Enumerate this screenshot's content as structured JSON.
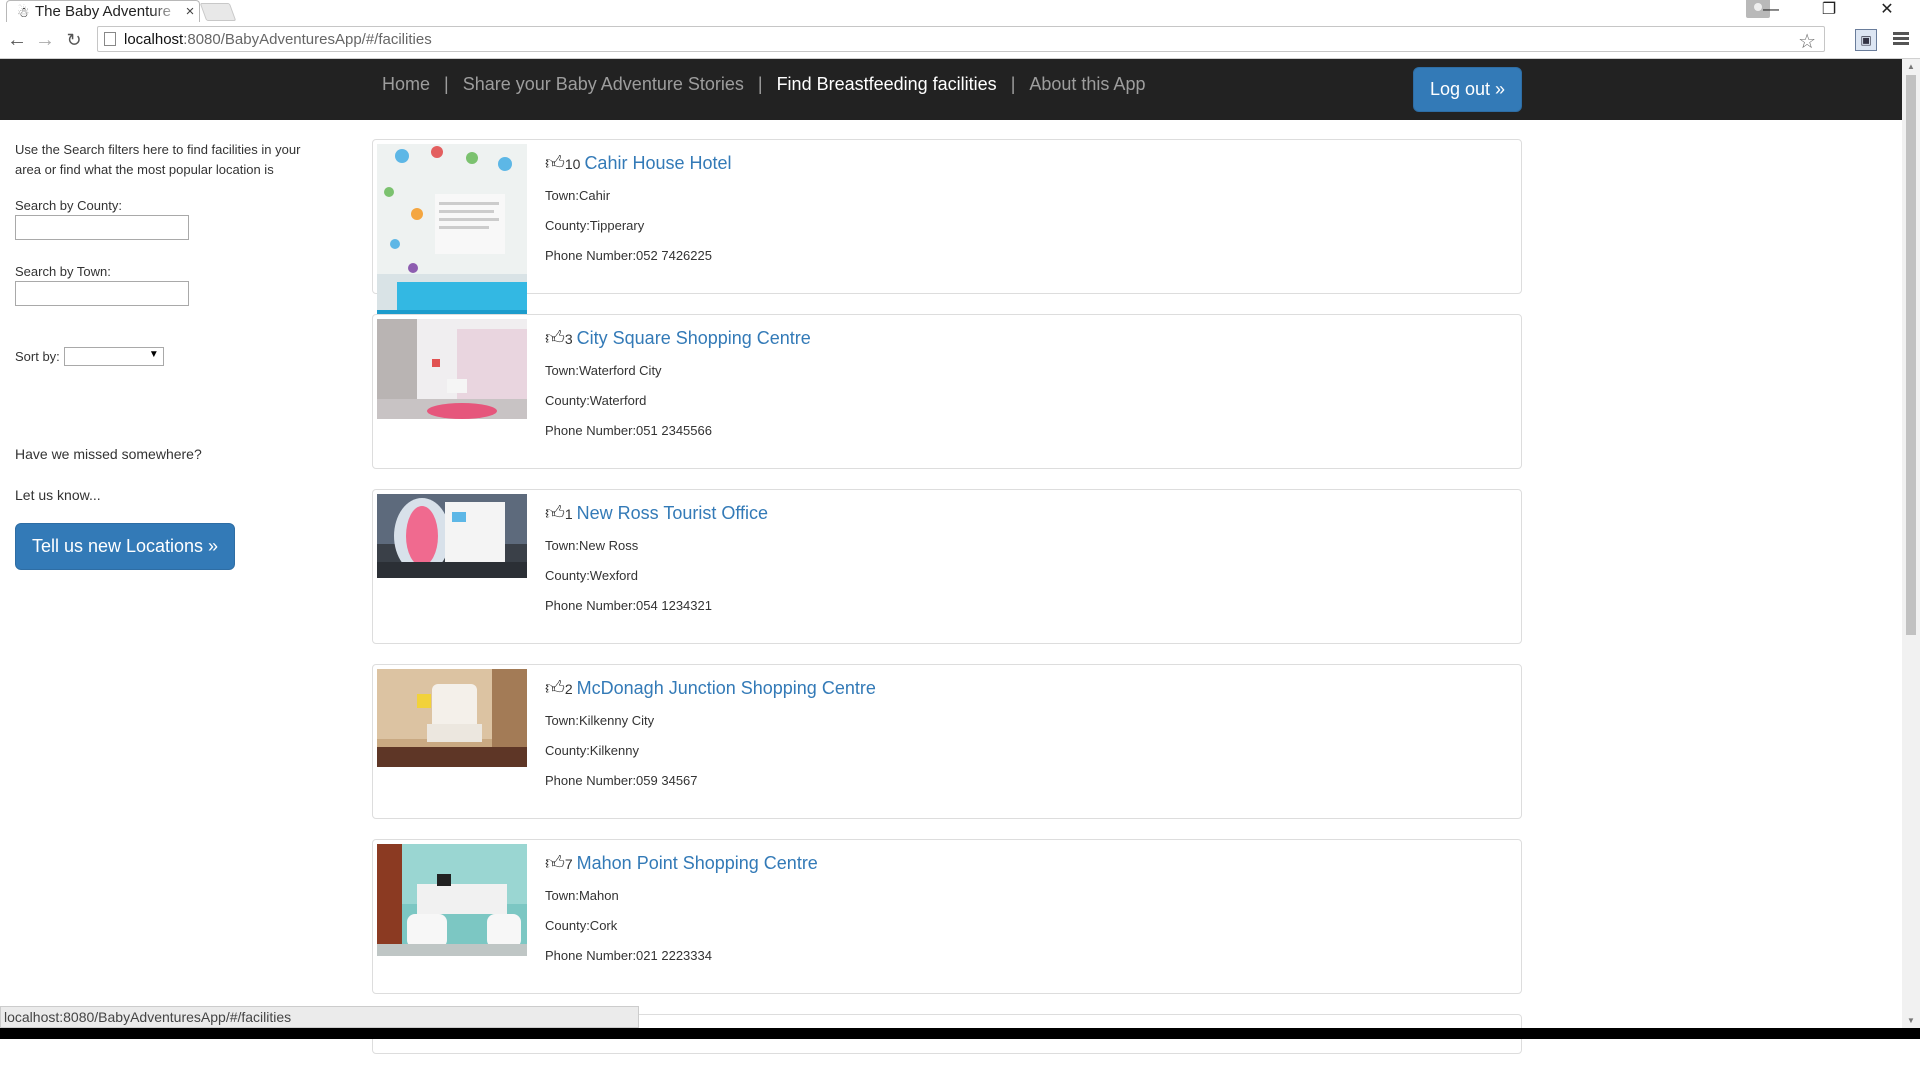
{
  "browser": {
    "tab_title": "The Baby Adventure",
    "tab_close": "×",
    "url_host": "localhost",
    "url_rest": ":8080/BabyAdventuresApp/#/facilities",
    "status_url": "localhost:8080/BabyAdventuresApp/#/facilities",
    "icons": [
      "back-icon",
      "forward-icon",
      "reload-icon",
      "star-icon",
      "menu-icon",
      "minimize-icon",
      "maximize-icon",
      "close-icon"
    ]
  },
  "nav": {
    "home": "Home",
    "share": "Share your Baby Adventure Stories",
    "find": "Find Breastfeeding facilities",
    "about": "About this App",
    "separator": "|",
    "logout": "Log out »"
  },
  "sidebar": {
    "intro": "Use the Search filters here to find facilities in your area or find what the most popular location is",
    "county_label": "Search by County:",
    "town_label": "Search by Town:",
    "sort_label": "Sort by:",
    "sort_value": "",
    "missed": "Have we missed somewhere?",
    "letus": "Let us know...",
    "new_locations_button": "Tell us new Locations »"
  },
  "facilities": [
    {
      "likes": "10",
      "name": "Cahir House Hotel",
      "town": "Town:Cahir",
      "county": "County:Tipperary",
      "phone": "Phone Number:052 7426225"
    },
    {
      "likes": "3",
      "name": "City Square Shopping Centre",
      "town": "Town:Waterford City",
      "county": "County:Waterford",
      "phone": "Phone Number:051 2345566"
    },
    {
      "likes": "1",
      "name": "New Ross Tourist Office",
      "town": "Town:New Ross",
      "county": "County:Wexford",
      "phone": "Phone Number:054 1234321"
    },
    {
      "likes": "2",
      "name": "McDonagh Junction Shopping Centre",
      "town": "Town:Kilkenny City",
      "county": "County:Kilkenny",
      "phone": "Phone Number:059 34567"
    },
    {
      "likes": "7",
      "name": "Mahon Point Shopping Centre",
      "town": "Town:Mahon",
      "county": "County:Cork",
      "phone": "Phone Number:021 2223334"
    }
  ],
  "colors": {
    "navbar": "#222222",
    "primary": "#337ab7",
    "link": "#337ab7"
  }
}
